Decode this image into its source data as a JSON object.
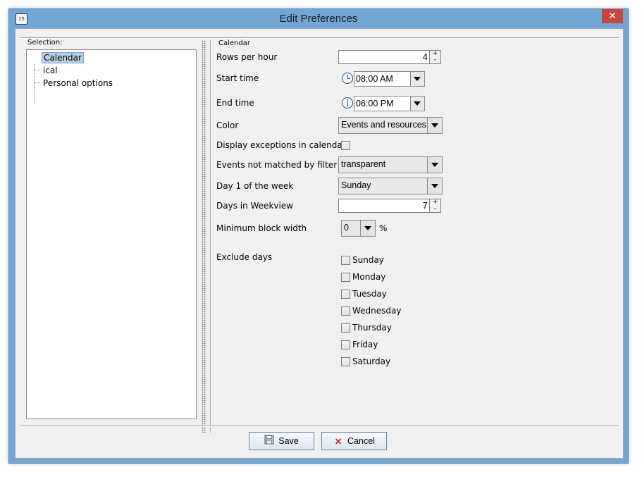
{
  "window": {
    "title": "Edit Preferences",
    "app_icon_text": "15",
    "close_glyph": "✕"
  },
  "selection": {
    "label": "Selection:",
    "tree": [
      {
        "label": "Calendar",
        "selected": true
      },
      {
        "label": "ical",
        "selected": false
      },
      {
        "label": "Personal options",
        "selected": false
      }
    ]
  },
  "panel": {
    "title": "Calendar",
    "rows_per_hour": {
      "label": "Rows per hour",
      "value": "4",
      "up": "+",
      "down": "-"
    },
    "start_time": {
      "label": "Start time",
      "value": "08:00 AM"
    },
    "end_time": {
      "label": "End time",
      "value": "06:00 PM"
    },
    "color": {
      "label": "Color",
      "value": "Events and resources"
    },
    "display_exceptions": {
      "label": "Display exceptions in calendar",
      "checked": false
    },
    "events_not_matched": {
      "label": "Events not matched by filter",
      "value": "transparent"
    },
    "day1_of_week": {
      "label": "Day 1 of the week",
      "value": "Sunday"
    },
    "days_in_weekview": {
      "label": "Days in Weekview",
      "value": "7",
      "up": "+",
      "down": "-"
    },
    "min_block_width": {
      "label": "Minimum block width",
      "value": "0",
      "unit": "%"
    },
    "exclude_days": {
      "label": "Exclude days",
      "days": [
        "Sunday",
        "Monday",
        "Tuesday",
        "Wednesday",
        "Thursday",
        "Friday",
        "Saturday"
      ]
    }
  },
  "buttons": {
    "save": "Save",
    "cancel": "Cancel",
    "cancel_glyph": "✕"
  },
  "colors": {
    "window_frame": "#71a6d5",
    "close_button": "#c7463b",
    "selected_tree_item": "#b8cfe5",
    "cancel_icon": "#d0201a"
  }
}
